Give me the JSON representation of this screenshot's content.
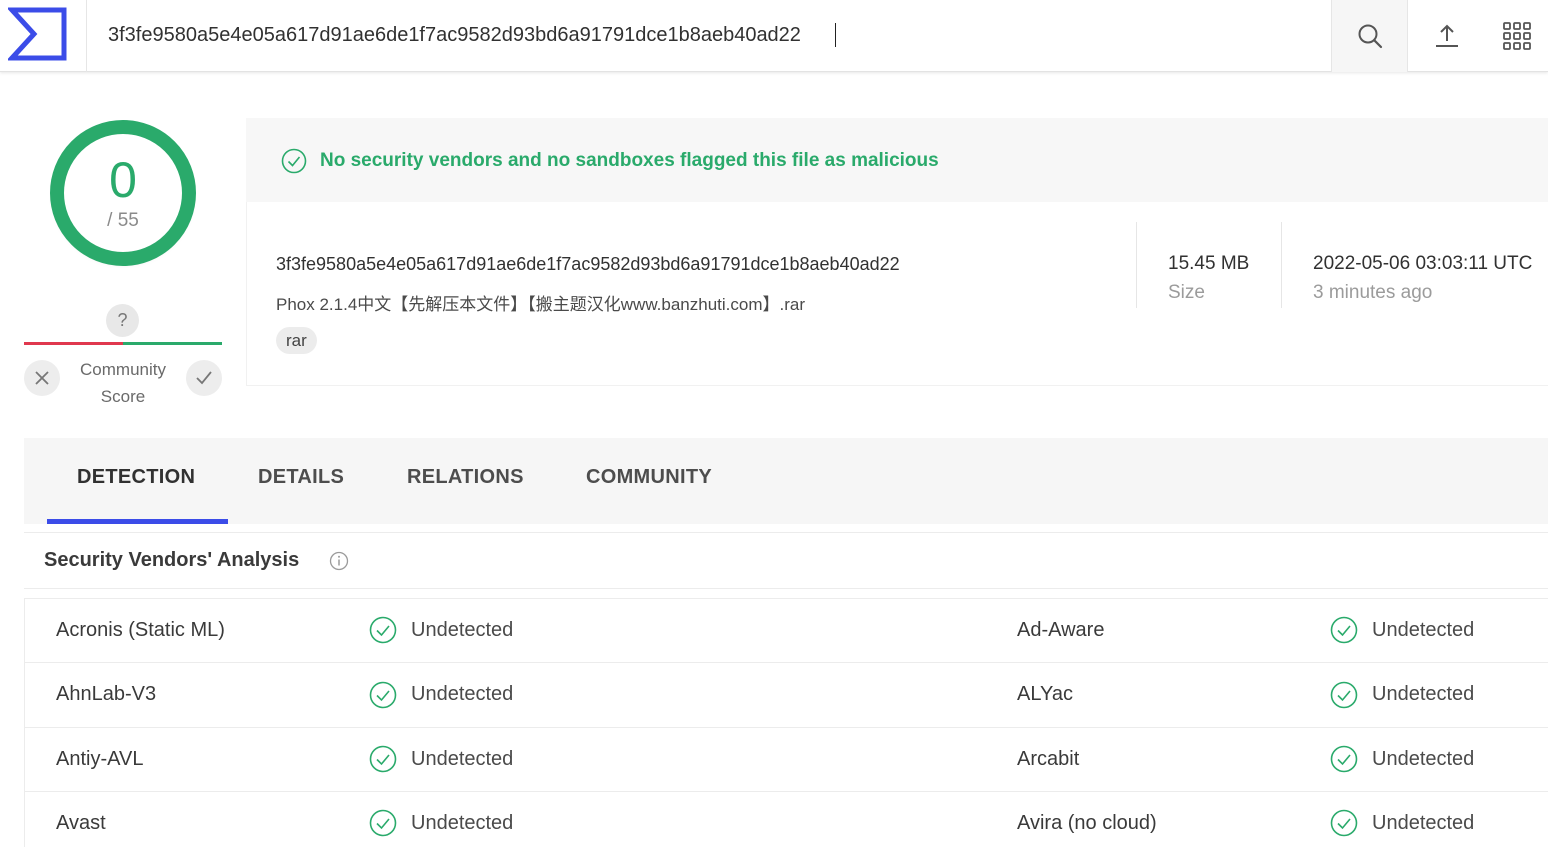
{
  "topbar": {
    "search_value": "3f3fe9580a5e4e05a617d91ae6de1f7ac9582d93bd6a91791dce1b8aeb40ad22",
    "icons": [
      "virustotal-logo",
      "search-icon",
      "upload-icon",
      "apps-grid-icon"
    ]
  },
  "score": {
    "detected": "0",
    "total": "/ 55",
    "fraction": 0
  },
  "community": {
    "unknown": "?",
    "label_line1": "Community",
    "label_line2": "Score"
  },
  "banner": {
    "text": "No security vendors and no sandboxes flagged this file as malicious"
  },
  "file": {
    "hash": "3f3fe9580a5e4e05a617d91ae6de1f7ac9582d93bd6a91791dce1b8aeb40ad22",
    "name": "Phox 2.1.4中文【先解压本文件】【搬主题汉化www.banzhuti.com】.rar",
    "tag": "rar",
    "size_value": "15.45 MB",
    "size_label": "Size",
    "date_value": "2022-05-06 03:03:11 UTC",
    "date_label": "3 minutes ago"
  },
  "tabs": [
    {
      "label": "DETECTION",
      "active": true
    },
    {
      "label": "DETAILS",
      "active": false
    },
    {
      "label": "RELATIONS",
      "active": false
    },
    {
      "label": "COMMUNITY",
      "active": false
    }
  ],
  "section": {
    "title": "Security Vendors' Analysis"
  },
  "vendors": [
    {
      "left_name": "Acronis (Static ML)",
      "left_status": "Undetected",
      "right_name": "Ad-Aware",
      "right_status": "Undetected"
    },
    {
      "left_name": "AhnLab-V3",
      "left_status": "Undetected",
      "right_name": "ALYac",
      "right_status": "Undetected"
    },
    {
      "left_name": "Antiy-AVL",
      "left_status": "Undetected",
      "right_name": "Arcabit",
      "right_status": "Undetected"
    },
    {
      "left_name": "Avast",
      "left_status": "Undetected",
      "right_name": "Avira (no cloud)",
      "right_status": "Undetected"
    }
  ],
  "colors": {
    "green": "#2aaa6b",
    "red": "#e0384e",
    "accent_blue": "#3b4ce8"
  }
}
